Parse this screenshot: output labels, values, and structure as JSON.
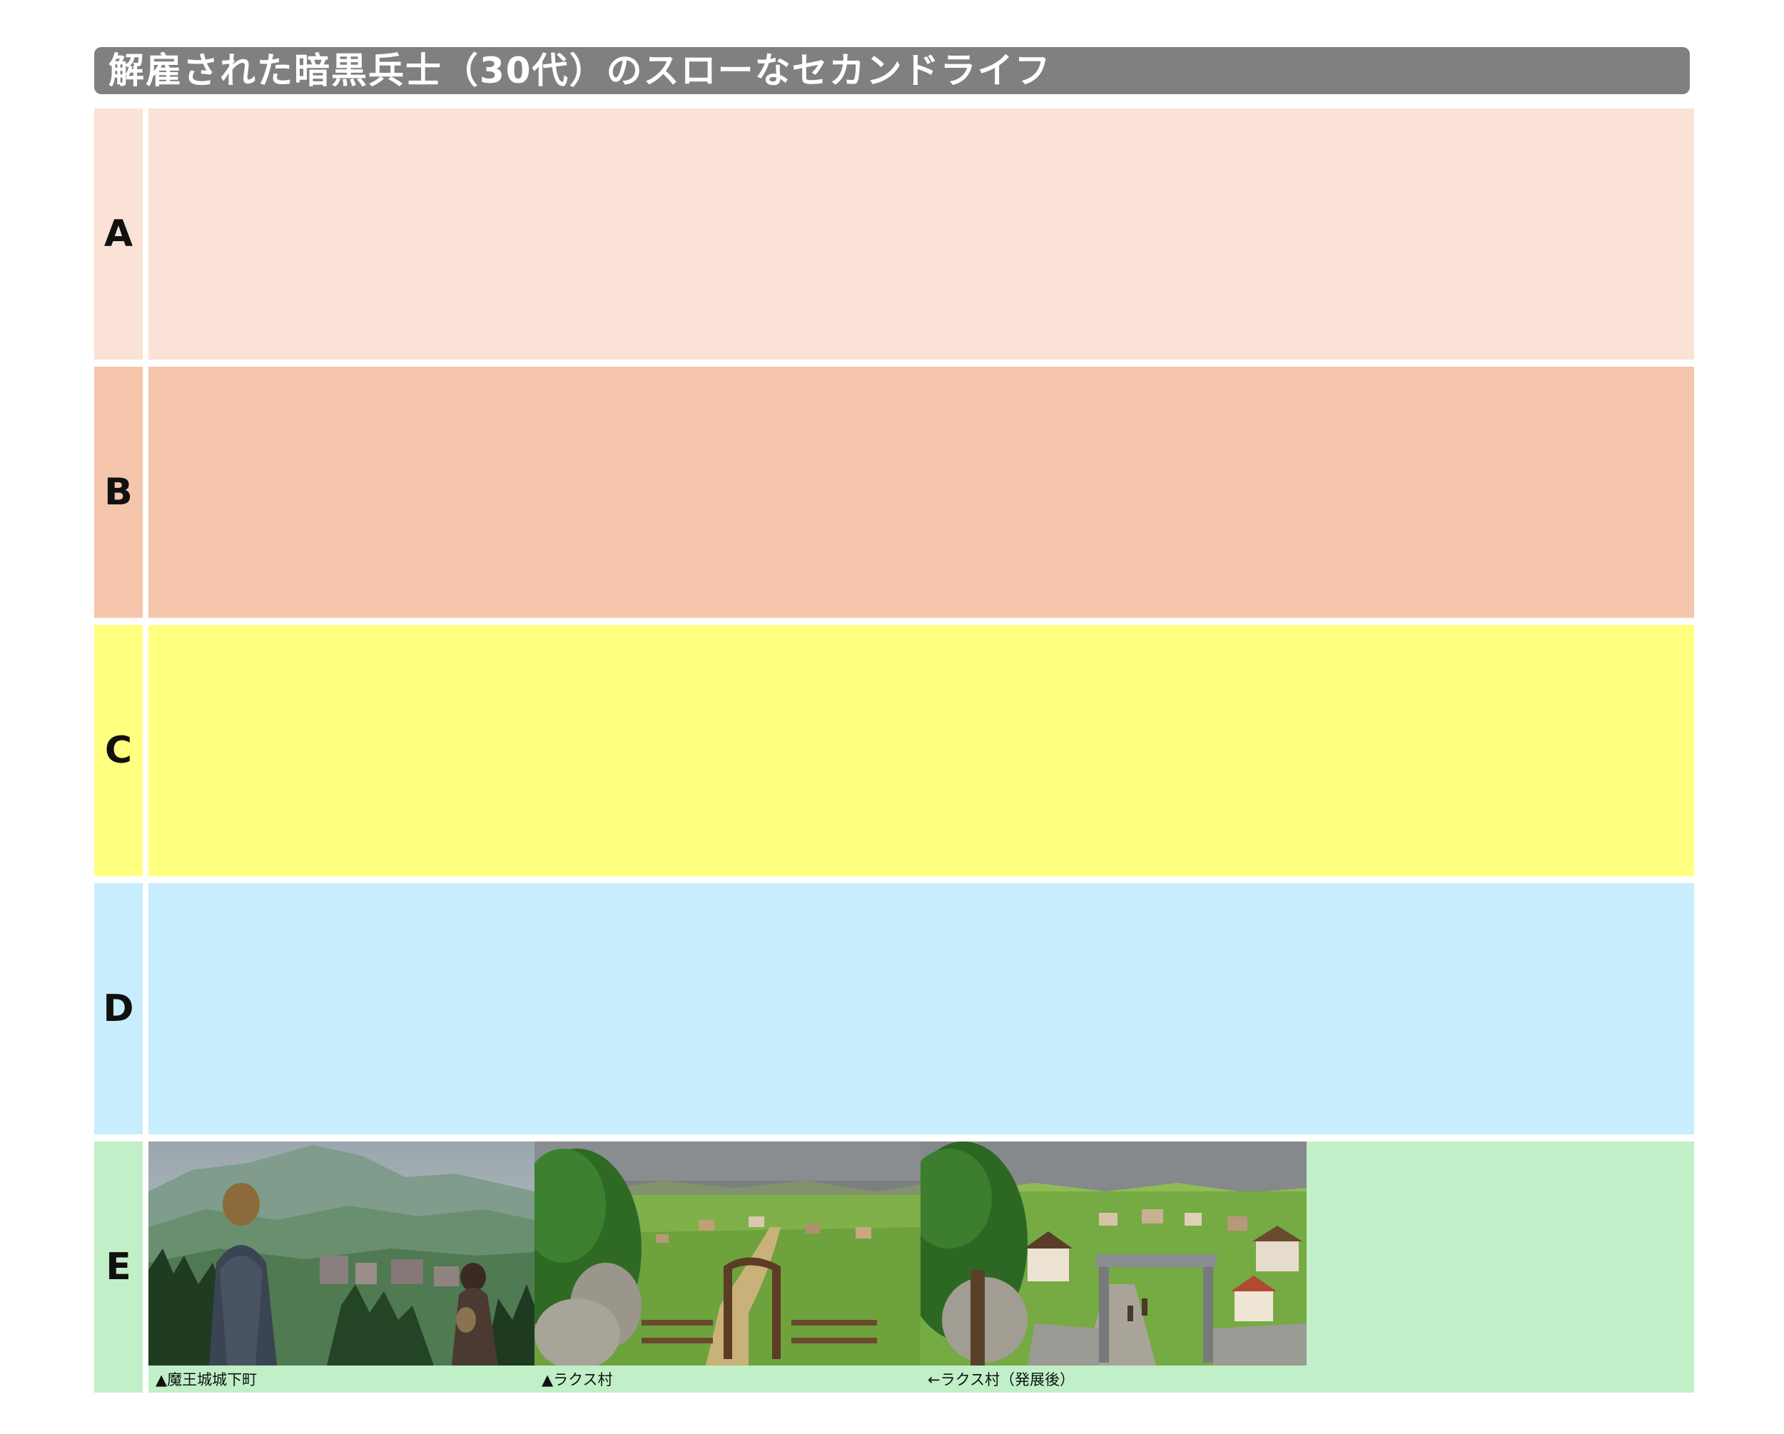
{
  "title": "解雇された暗黒兵士（30代）のスローなセカンドライフ",
  "colors": {
    "title_bg": "#808080",
    "tier_A": "#fbe2d6",
    "tier_B": "#f5c5ac",
    "tier_C": "#ffff80",
    "tier_D": "#c8edfc",
    "tier_E": "#c1f0c8"
  },
  "tiers": [
    {
      "label": "A",
      "items": []
    },
    {
      "label": "B",
      "items": []
    },
    {
      "label": "C",
      "items": []
    },
    {
      "label": "D",
      "items": []
    },
    {
      "label": "E",
      "items": [
        {
          "caption": "▲魔王城城下町",
          "image": "castle-town-landscape"
        },
        {
          "caption": "▲ラクス村",
          "image": "lux-village-gate"
        },
        {
          "caption": "←ラクス村（発展後）",
          "image": "lux-village-developed"
        }
      ]
    }
  ]
}
